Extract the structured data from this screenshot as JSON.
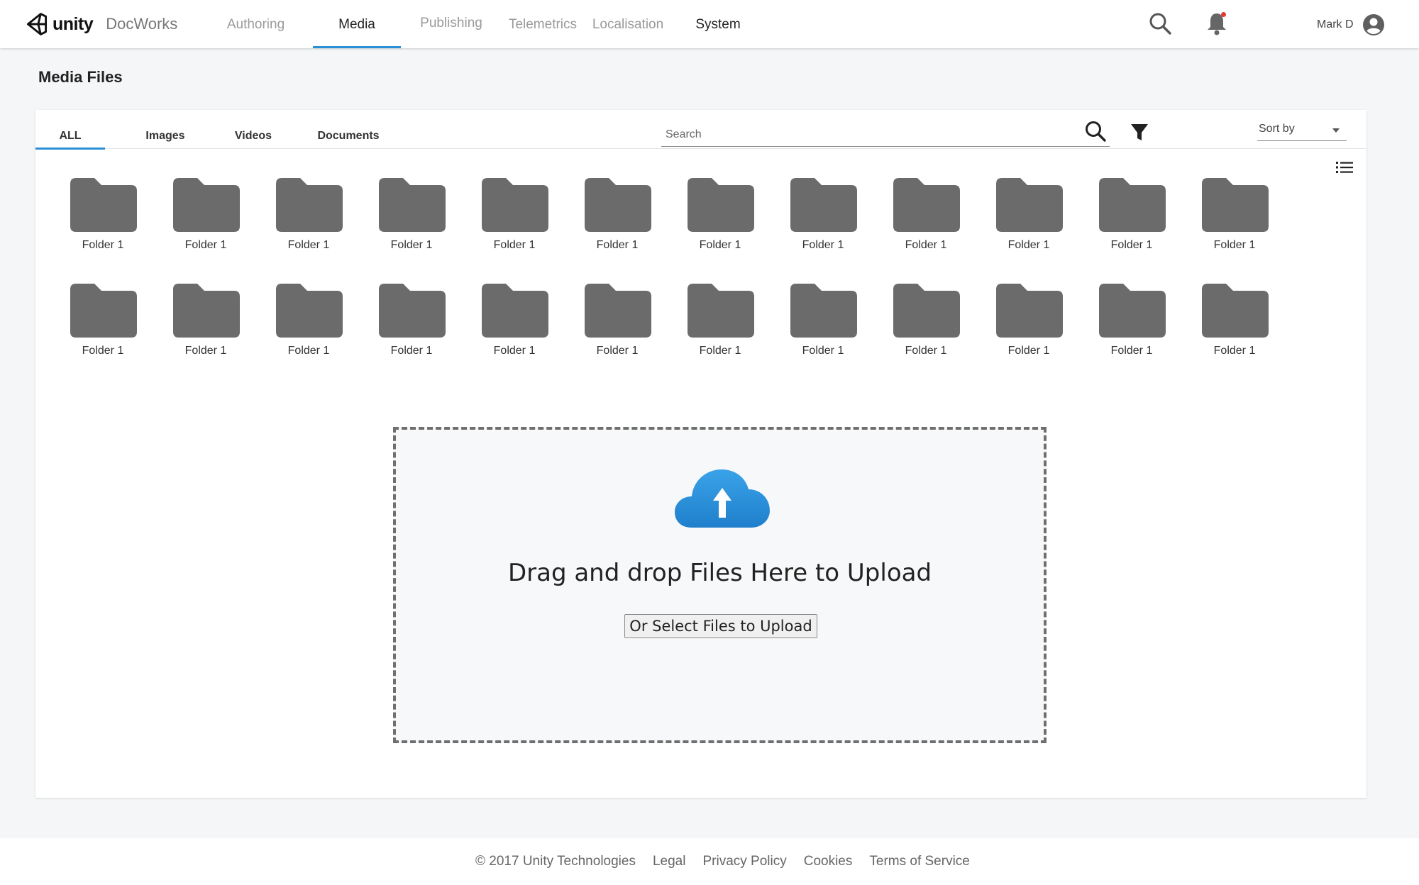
{
  "header": {
    "brand": "unity",
    "product": "DocWorks",
    "nav": [
      {
        "label": "Authoring"
      },
      {
        "label": "Media"
      },
      {
        "label": "Publishing"
      },
      {
        "label": "Telemetrics"
      },
      {
        "label": "Localisation"
      },
      {
        "label": "System"
      }
    ],
    "active_nav": "Media",
    "user_name": "Mark D",
    "notification_badge_color": "#e53935",
    "accent_color": "#2a8fd6"
  },
  "page": {
    "title": "Media Files"
  },
  "toolbar": {
    "tabs": [
      {
        "label": "ALL"
      },
      {
        "label": "Images"
      },
      {
        "label": "Videos"
      },
      {
        "label": "Documents"
      }
    ],
    "active_tab": "ALL",
    "search_placeholder": "Search",
    "sort_label": "Sort by"
  },
  "folders": {
    "rows": [
      [
        "Folder 1",
        "Folder 1",
        "Folder 1",
        "Folder 1",
        "Folder 1",
        "Folder 1",
        "Folder 1",
        "Folder 1",
        "Folder 1",
        "Folder 1",
        "Folder 1",
        "Folder 1"
      ],
      [
        "Folder 1",
        "Folder 1",
        "Folder 1",
        "Folder 1",
        "Folder 1",
        "Folder 1",
        "Folder 1",
        "Folder 1",
        "Folder 1",
        "Folder 1",
        "Folder 1",
        "Folder 1"
      ]
    ],
    "folder_color": "#6b6b6b"
  },
  "upload": {
    "drop_text": "Drag and drop Files Here to Upload",
    "select_label": "Or Select Files to Upload",
    "cloud_color": "#2a8fd6"
  },
  "footer": {
    "copyright": "© 2017 Unity Technologies",
    "links": [
      "Legal",
      "Privacy Policy",
      "Cookies",
      "Terms of Service"
    ]
  }
}
